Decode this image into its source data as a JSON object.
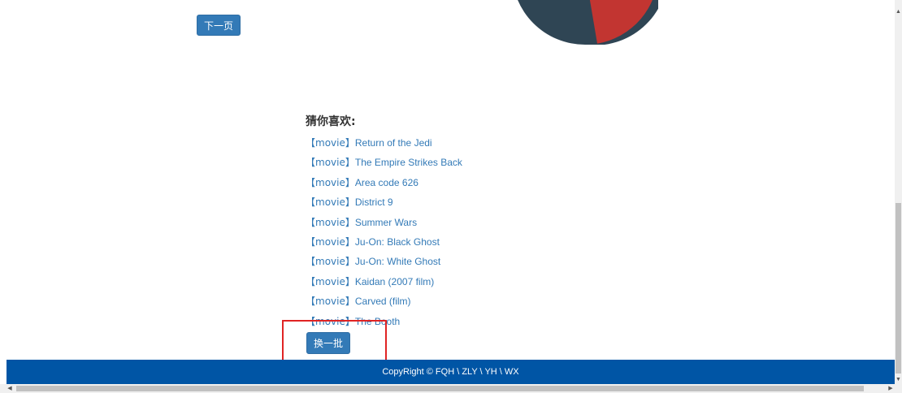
{
  "nav": {
    "next_page_label": "下一页"
  },
  "chart": {
    "type": "pie",
    "colors": [
      "#2f4554",
      "#c23531"
    ]
  },
  "recommend": {
    "title": "猜你喜欢:",
    "items": [
      {
        "tag": "【movie】",
        "title": "Return of the Jedi"
      },
      {
        "tag": "【movie】",
        "title": "The Empire Strikes Back"
      },
      {
        "tag": "【movie】",
        "title": "Area code 626"
      },
      {
        "tag": "【movie】",
        "title": "District 9"
      },
      {
        "tag": "【movie】",
        "title": "Summer Wars"
      },
      {
        "tag": "【movie】",
        "title": "Ju-On: Black Ghost"
      },
      {
        "tag": "【movie】",
        "title": "Ju-On: White Ghost"
      },
      {
        "tag": "【movie】",
        "title": "Kaidan (2007 film)"
      },
      {
        "tag": "【movie】",
        "title": "Carved (film)"
      },
      {
        "tag": "【movie】",
        "title": "The Booth"
      }
    ],
    "refresh_label": "换一批"
  },
  "footer": {
    "copyright": "CopyRight © FQH \\ ZLY \\ YH \\ WX"
  },
  "colors": {
    "primary": "#337ab7",
    "footer_bg": "#0055a5",
    "highlight": "#e02424"
  }
}
